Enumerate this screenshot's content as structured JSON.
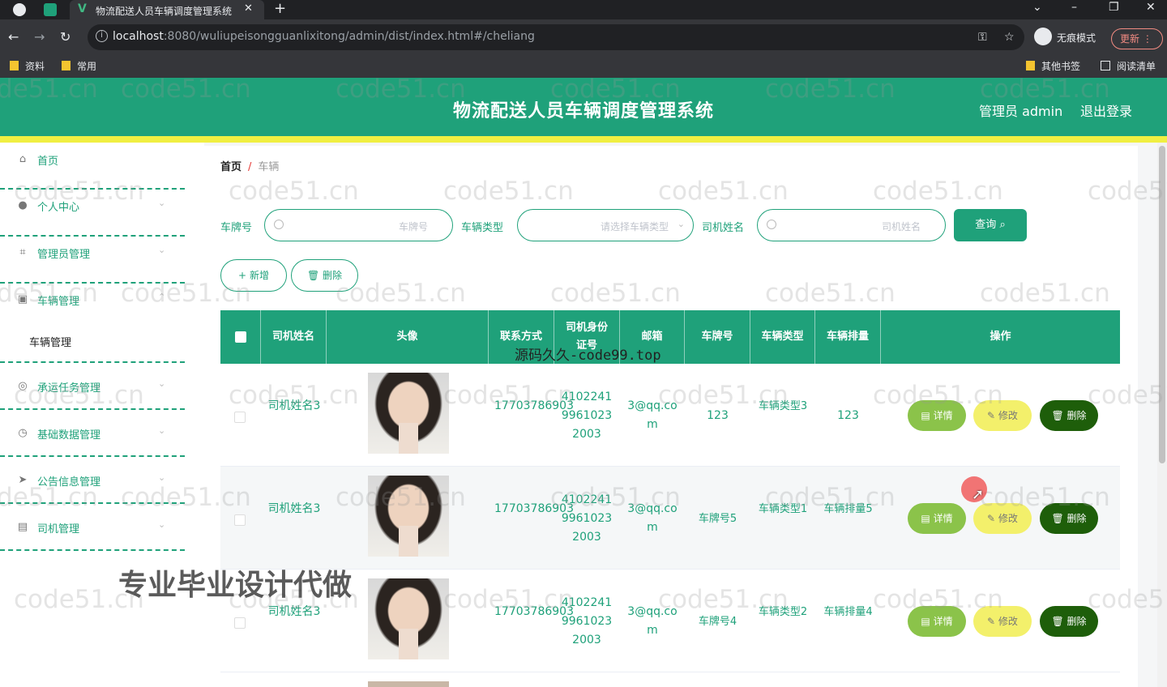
{
  "browser": {
    "tab_title": "物流配送人员车辆调度管理系统",
    "url_host": "localhost",
    "url_path": ":8080/wuliupeisongguanlixitong/admin/dist/index.html#/cheliang",
    "incognito_label": "无痕模式",
    "update_label": "更新",
    "bookmarks": [
      "资料",
      "常用"
    ],
    "bookmarks_right": [
      "其他书签",
      "阅读清单"
    ]
  },
  "header": {
    "title": "物流配送人员车辆调度管理系统",
    "user_label": "管理员 admin",
    "logout_label": "退出登录",
    "brand_color": "#1fa17a"
  },
  "sidebar": {
    "items": [
      {
        "label": "首页",
        "icon": "home-icon"
      },
      {
        "label": "个人中心",
        "icon": "user-icon"
      },
      {
        "label": "管理员管理",
        "icon": "crop-icon"
      },
      {
        "label": "车辆管理",
        "icon": "vehicle-icon"
      },
      {
        "label": "承运任务管理",
        "icon": "task-icon"
      },
      {
        "label": "基础数据管理",
        "icon": "compass-icon"
      },
      {
        "label": "公告信息管理",
        "icon": "send-icon"
      },
      {
        "label": "司机管理",
        "icon": "document-icon"
      }
    ],
    "subitem": "车辆管理"
  },
  "breadcrumb": {
    "home": "首页",
    "sep": "/",
    "current": "车辆"
  },
  "filters": {
    "plate_label": "车牌号",
    "plate_placeholder": "车牌号",
    "type_label": "车辆类型",
    "type_placeholder": "请选择车辆类型",
    "driver_label": "司机姓名",
    "driver_placeholder": "司机姓名",
    "search_label": "查询"
  },
  "actions": {
    "add_label": "新增",
    "delete_label": "删除"
  },
  "table": {
    "columns": [
      "司机姓名",
      "头像",
      "联系方式",
      "司机身份证号",
      "邮箱",
      "车牌号",
      "车辆类型",
      "车辆排量",
      "操作"
    ],
    "row_buttons": {
      "detail": "详情",
      "edit": "修改",
      "delete": "删除"
    },
    "rows": [
      {
        "driver_name": "司机姓名3",
        "phone": "17703786903",
        "id_card": "410224199610232003",
        "email": "3@qq.com",
        "plate": "123",
        "type": "车辆类型3",
        "displacement": "123"
      },
      {
        "driver_name": "司机姓名3",
        "phone": "17703786903",
        "id_card": "410224199610232003",
        "email": "3@qq.com",
        "plate": "车牌号5",
        "type": "车辆类型1",
        "displacement": "车辆排量5"
      },
      {
        "driver_name": "司机姓名3",
        "phone": "17703786903",
        "id_card": "410224199610232003",
        "email": "3@qq.com",
        "plate": "车牌号4",
        "type": "车辆类型2",
        "displacement": "车辆排量4"
      }
    ]
  },
  "overlays": {
    "watermark": "code51.cn",
    "watermark_mid": "源码久久-code99.top",
    "watermark_ad": "专业毕业设计代做"
  }
}
